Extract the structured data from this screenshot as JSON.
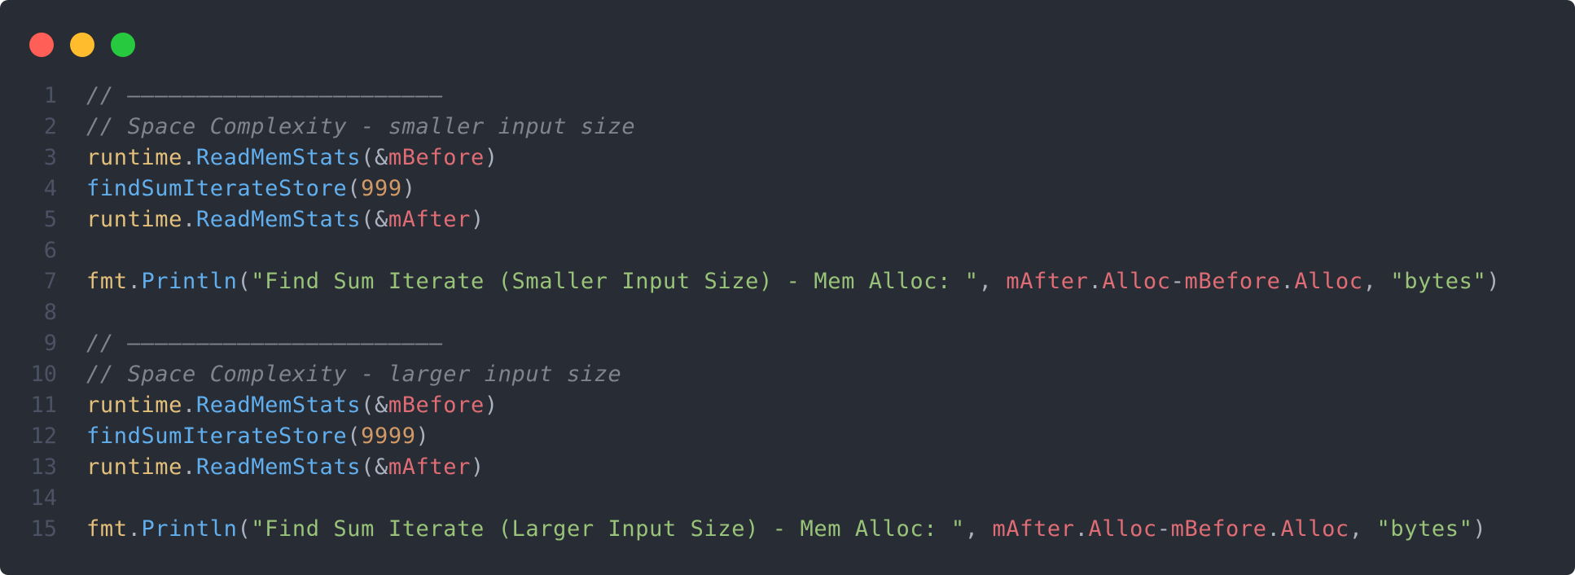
{
  "window": {
    "background": "#282c34",
    "controls": [
      {
        "name": "close",
        "color": "#ff5f56"
      },
      {
        "name": "minimize",
        "color": "#ffbd2e"
      },
      {
        "name": "maximize",
        "color": "#27c93f"
      }
    ]
  },
  "theme": {
    "comment": "#7f848e",
    "package": "#e5c07b",
    "function": "#61afef",
    "variable": "#e06c75",
    "number": "#d19a66",
    "string": "#98c379",
    "plain": "#abb2bf",
    "line_number": "#4b5263"
  },
  "code": {
    "lines": [
      {
        "n": "1",
        "tokens": [
          {
            "t": "comment",
            "v": "// ———————————————————————"
          }
        ]
      },
      {
        "n": "2",
        "tokens": [
          {
            "t": "comment",
            "v": "// Space Complexity - smaller input size"
          }
        ]
      },
      {
        "n": "3",
        "tokens": [
          {
            "t": "pkg",
            "v": "runtime"
          },
          {
            "t": "plain",
            "v": "."
          },
          {
            "t": "func",
            "v": "ReadMemStats"
          },
          {
            "t": "plain",
            "v": "(&"
          },
          {
            "t": "var",
            "v": "mBefore"
          },
          {
            "t": "plain",
            "v": ")"
          }
        ]
      },
      {
        "n": "4",
        "tokens": [
          {
            "t": "func",
            "v": "findSumIterateStore"
          },
          {
            "t": "plain",
            "v": "("
          },
          {
            "t": "num",
            "v": "999"
          },
          {
            "t": "plain",
            "v": ")"
          }
        ]
      },
      {
        "n": "5",
        "tokens": [
          {
            "t": "pkg",
            "v": "runtime"
          },
          {
            "t": "plain",
            "v": "."
          },
          {
            "t": "func",
            "v": "ReadMemStats"
          },
          {
            "t": "plain",
            "v": "(&"
          },
          {
            "t": "var",
            "v": "mAfter"
          },
          {
            "t": "plain",
            "v": ")"
          }
        ]
      },
      {
        "n": "6",
        "tokens": []
      },
      {
        "n": "7",
        "tokens": [
          {
            "t": "pkg",
            "v": "fmt"
          },
          {
            "t": "plain",
            "v": "."
          },
          {
            "t": "func",
            "v": "Println"
          },
          {
            "t": "plain",
            "v": "("
          },
          {
            "t": "str",
            "v": "\"Find Sum Iterate (Smaller Input Size) - Mem Alloc: \""
          },
          {
            "t": "plain",
            "v": ", "
          },
          {
            "t": "var",
            "v": "mAfter"
          },
          {
            "t": "plain",
            "v": "."
          },
          {
            "t": "var",
            "v": "Alloc"
          },
          {
            "t": "plain",
            "v": "-"
          },
          {
            "t": "var",
            "v": "mBefore"
          },
          {
            "t": "plain",
            "v": "."
          },
          {
            "t": "var",
            "v": "Alloc"
          },
          {
            "t": "plain",
            "v": ", "
          },
          {
            "t": "str",
            "v": "\"bytes\""
          },
          {
            "t": "plain",
            "v": ")"
          }
        ]
      },
      {
        "n": "8",
        "tokens": []
      },
      {
        "n": "9",
        "tokens": [
          {
            "t": "comment",
            "v": "// ———————————————————————"
          }
        ]
      },
      {
        "n": "10",
        "tokens": [
          {
            "t": "comment",
            "v": "// Space Complexity - larger input size"
          }
        ]
      },
      {
        "n": "11",
        "tokens": [
          {
            "t": "pkg",
            "v": "runtime"
          },
          {
            "t": "plain",
            "v": "."
          },
          {
            "t": "func",
            "v": "ReadMemStats"
          },
          {
            "t": "plain",
            "v": "(&"
          },
          {
            "t": "var",
            "v": "mBefore"
          },
          {
            "t": "plain",
            "v": ")"
          }
        ]
      },
      {
        "n": "12",
        "tokens": [
          {
            "t": "func",
            "v": "findSumIterateStore"
          },
          {
            "t": "plain",
            "v": "("
          },
          {
            "t": "num",
            "v": "9999"
          },
          {
            "t": "plain",
            "v": ")"
          }
        ]
      },
      {
        "n": "13",
        "tokens": [
          {
            "t": "pkg",
            "v": "runtime"
          },
          {
            "t": "plain",
            "v": "."
          },
          {
            "t": "func",
            "v": "ReadMemStats"
          },
          {
            "t": "plain",
            "v": "(&"
          },
          {
            "t": "var",
            "v": "mAfter"
          },
          {
            "t": "plain",
            "v": ")"
          }
        ]
      },
      {
        "n": "14",
        "tokens": []
      },
      {
        "n": "15",
        "tokens": [
          {
            "t": "pkg",
            "v": "fmt"
          },
          {
            "t": "plain",
            "v": "."
          },
          {
            "t": "func",
            "v": "Println"
          },
          {
            "t": "plain",
            "v": "("
          },
          {
            "t": "str",
            "v": "\"Find Sum Iterate (Larger Input Size) - Mem Alloc: \""
          },
          {
            "t": "plain",
            "v": ", "
          },
          {
            "t": "var",
            "v": "mAfter"
          },
          {
            "t": "plain",
            "v": "."
          },
          {
            "t": "var",
            "v": "Alloc"
          },
          {
            "t": "plain",
            "v": "-"
          },
          {
            "t": "var",
            "v": "mBefore"
          },
          {
            "t": "plain",
            "v": "."
          },
          {
            "t": "var",
            "v": "Alloc"
          },
          {
            "t": "plain",
            "v": ", "
          },
          {
            "t": "str",
            "v": "\"bytes\""
          },
          {
            "t": "plain",
            "v": ")"
          }
        ]
      }
    ]
  }
}
